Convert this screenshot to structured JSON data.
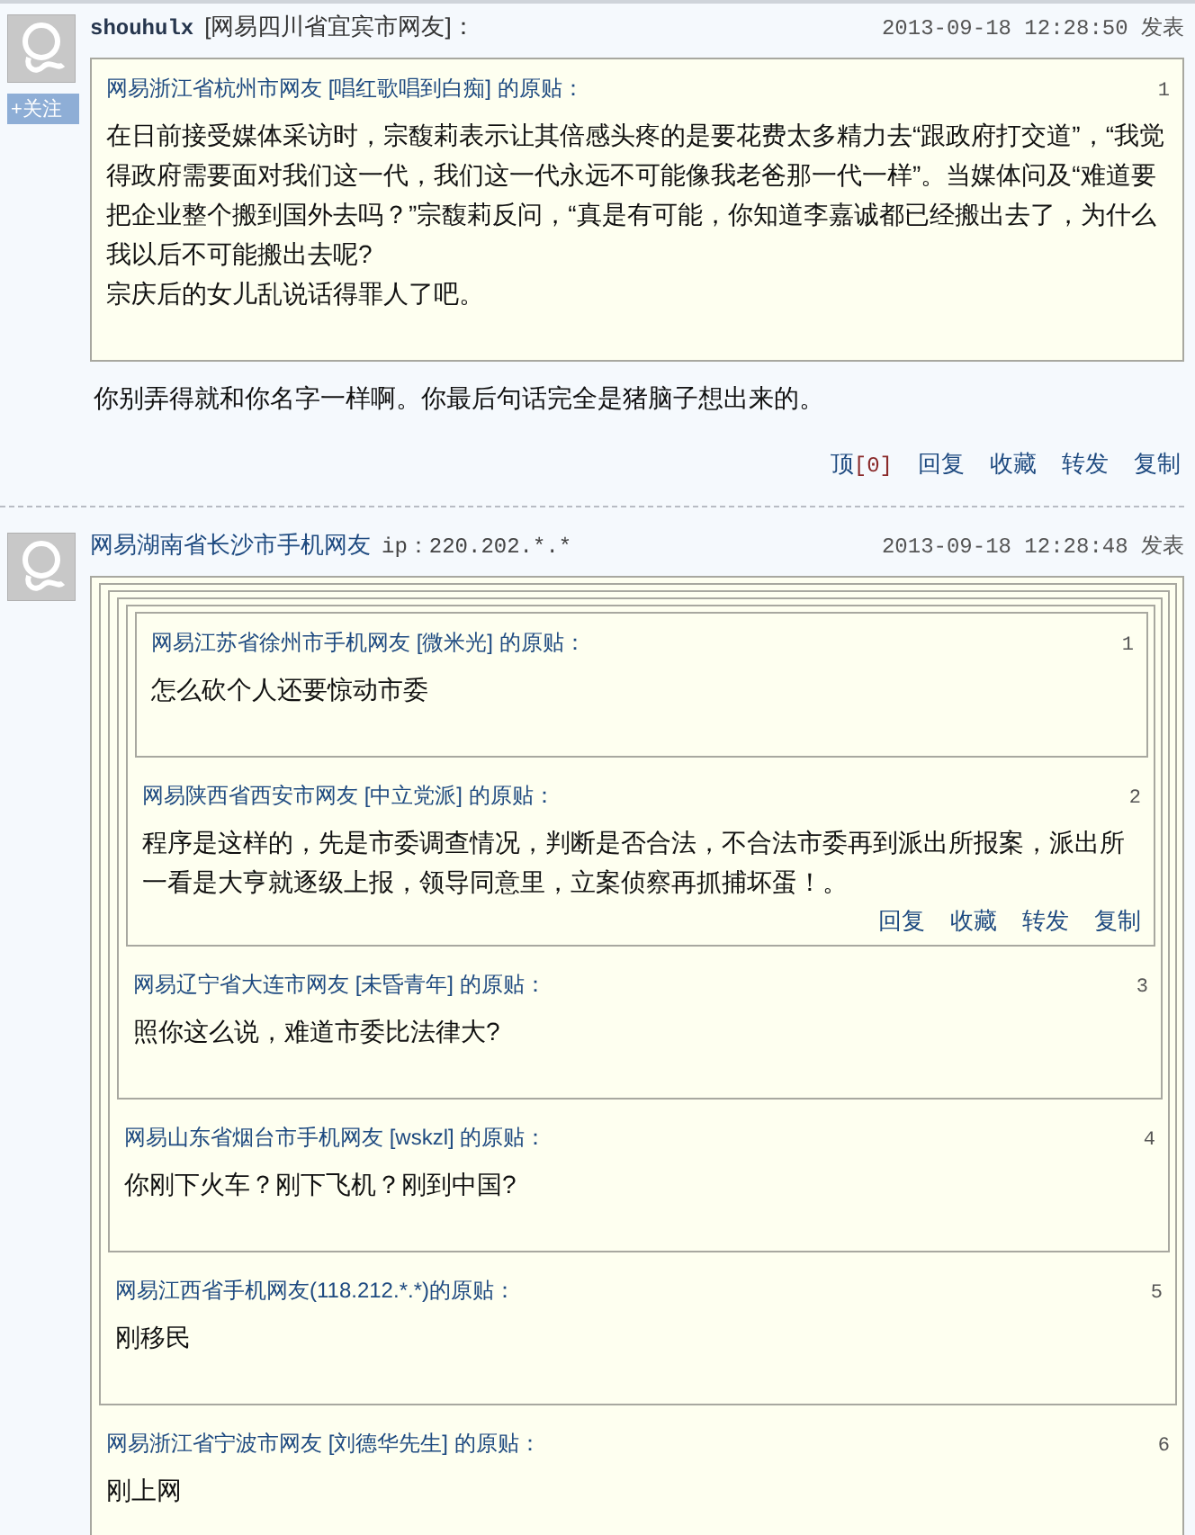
{
  "posts": [
    {
      "user": "shouhulx",
      "location": "[网易四川省宜宾市网友]：",
      "time": "2013-09-18 12:28:50 发表",
      "follow": "+关注",
      "quote": {
        "source": "网易浙江省杭州市网友 [唱红歌唱到白痴] 的原贴：",
        "number": "1",
        "text": "在日前接受媒体采访时，宗馥莉表示让其倍感头疼的是要花费太多精力去“跟政府打交道”，“我觉得政府需要面对我们这一代，我们这一代永远不可能像我老爸那一代一样”。当媒体问及“难道要把企业整个搬到国外去吗？”宗馥莉反问，“真是有可能，你知道李嘉诚都已经搬出去了，为什么我以后不可能搬出去呢?\n宗庆后的女儿乱说话得罪人了吧。"
      },
      "text": "你别弄得就和你名字一样啊。你最后句话完全是猪脑子想出来的。",
      "actions": [
        {
          "label": "顶",
          "count": "[0]"
        },
        {
          "label": "回复"
        },
        {
          "label": "收藏"
        },
        {
          "label": "转发"
        },
        {
          "label": "复制"
        }
      ]
    },
    {
      "user": "网易湖南省长沙市手机网友",
      "ip": "ip：220.202.*.*",
      "time": "2013-09-18 12:28:48 发表",
      "quote": {
        "source": "网易浙江省宁波市网友 [刘德华先生] 的原贴：",
        "number": "6",
        "text": "刚上网",
        "quote": {
          "source": "网易江西省手机网友(118.212.*.*)的原贴：",
          "number": "5",
          "text": "刚移民",
          "quote": {
            "source": "网易山东省烟台市手机网友 [wskzl] 的原贴：",
            "number": "4",
            "text": "你刚下火车？刚下飞机？刚到中国?",
            "quote": {
              "source": "网易辽宁省大连市网友 [未昏青年] 的原贴：",
              "number": "3",
              "text": "照你这么说，难道市委比法律大?",
              "quote": {
                "source": "网易陕西省西安市网友 [中立党派] 的原贴：",
                "number": "2",
                "text": "程序是这样的，先是市委调查情况，判断是否合法，不合法市委再到派出所报案，派出所一看是大亨就逐级上报，领导同意里，立案侦察再抓捕坏蛋！。",
                "actions": [
                  {
                    "label": "回复"
                  },
                  {
                    "label": "收藏"
                  },
                  {
                    "label": "转发"
                  },
                  {
                    "label": "复制"
                  }
                ],
                "quote": {
                  "source": "网易江苏省徐州市手机网友 [微米光] 的原贴：",
                  "number": "1",
                  "text": "怎么砍个人还要惊动市委"
                }
              }
            }
          }
        }
      }
    }
  ]
}
